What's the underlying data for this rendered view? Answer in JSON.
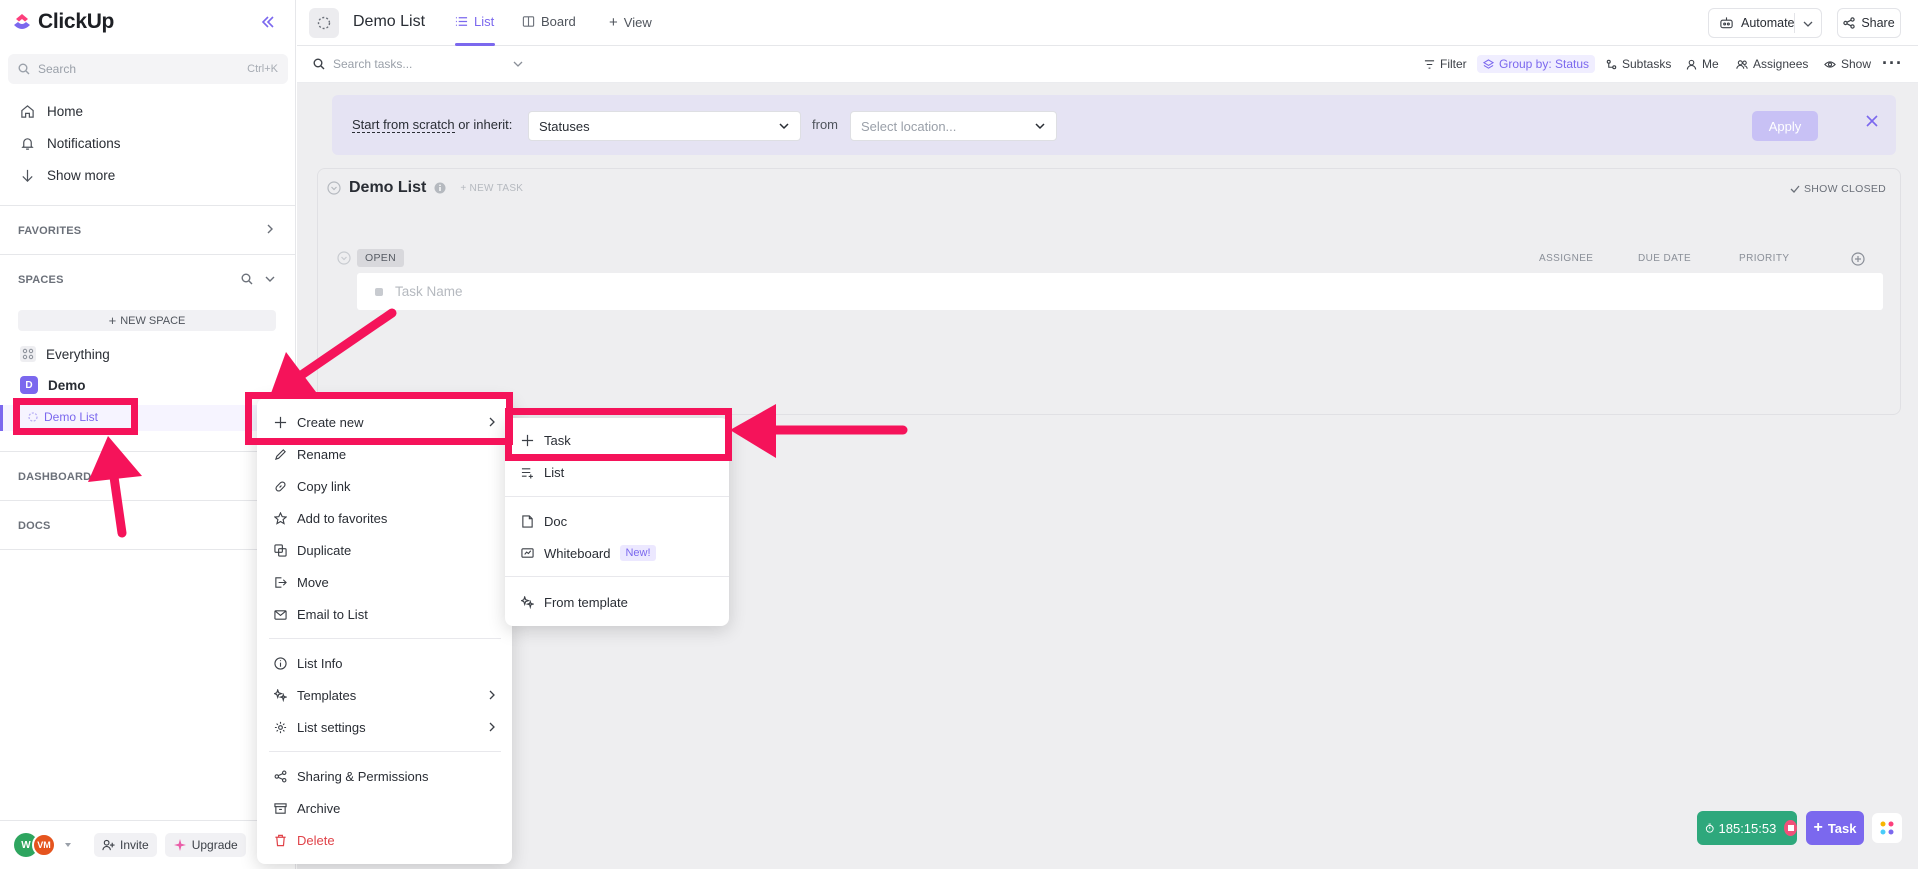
{
  "app": {
    "name": "ClickUp"
  },
  "sidebar": {
    "search_placeholder": "Search",
    "search_shortcut": "Ctrl+K",
    "nav": [
      {
        "label": "Home",
        "icon": "home-icon"
      },
      {
        "label": "Notifications",
        "icon": "bell-icon"
      },
      {
        "label": "Show more",
        "icon": "arrow-down-icon"
      }
    ],
    "favorites_label": "FAVORITES",
    "spaces_label": "SPACES",
    "new_space_label": "NEW SPACE",
    "everything_label": "Everything",
    "space": {
      "initial": "D",
      "name": "Demo",
      "color": "#7b68ee"
    },
    "active_list": "Demo List",
    "dashboards_label": "DASHBOARDS",
    "docs_label": "DOCS",
    "bottom": {
      "avatar_1": "W",
      "avatar_2": "VM",
      "invite_label": "Invite",
      "upgrade_label": "Upgrade"
    }
  },
  "header": {
    "title": "Demo List",
    "tabs": [
      {
        "label": "List",
        "active": true
      },
      {
        "label": "Board",
        "active": false
      }
    ],
    "add_view_label": "View",
    "automate_label": "Automate",
    "share_label": "Share"
  },
  "toolbar": {
    "search_placeholder": "Search tasks...",
    "filter_label": "Filter",
    "group_label": "Group by: Status",
    "subtasks_label": "Subtasks",
    "me_label": "Me",
    "assignees_label": "Assignees",
    "show_label": "Show"
  },
  "inherit_banner": {
    "start_label": "Start from scratch",
    "or_label": " or inherit:",
    "statuses_value": "Statuses",
    "from_label": "from",
    "location_placeholder": "Select location...",
    "apply_label": "Apply"
  },
  "list": {
    "title": "Demo List",
    "new_task_label": "+ NEW TASK",
    "show_closed_label": "SHOW CLOSED",
    "status_label": "OPEN",
    "columns": [
      "ASSIGNEE",
      "DUE DATE",
      "PRIORITY"
    ],
    "task_placeholder": "Task Name"
  },
  "timer": {
    "value": "185:15:53"
  },
  "task_fab_label": "Task",
  "context_menu": {
    "items": [
      {
        "label": "Create new",
        "icon": "plus-icon",
        "submenu": true
      },
      {
        "label": "Rename",
        "icon": "pencil-icon"
      },
      {
        "label": "Copy link",
        "icon": "link-icon"
      },
      {
        "label": "Add to favorites",
        "icon": "star-icon"
      },
      {
        "label": "Duplicate",
        "icon": "duplicate-icon"
      },
      {
        "label": "Move",
        "icon": "move-icon"
      },
      {
        "label": "Email to List",
        "icon": "mail-icon"
      },
      {
        "label": "List Info",
        "icon": "info-icon"
      },
      {
        "label": "Templates",
        "icon": "templates-icon",
        "submenu": true
      },
      {
        "label": "List settings",
        "icon": "gear-icon",
        "submenu": true
      },
      {
        "label": "Sharing & Permissions",
        "icon": "share-icon"
      },
      {
        "label": "Archive",
        "icon": "archive-icon"
      },
      {
        "label": "Delete",
        "icon": "trash-icon",
        "danger": true
      }
    ]
  },
  "create_submenu": {
    "items": [
      {
        "label": "Task",
        "icon": "plus-icon"
      },
      {
        "label": "List",
        "icon": "list-add-icon"
      },
      {
        "label": "Doc",
        "icon": "doc-icon"
      },
      {
        "label": "Whiteboard",
        "icon": "whiteboard-icon",
        "badge": "New!"
      },
      {
        "label": "From template",
        "icon": "template-icon"
      }
    ]
  },
  "colors": {
    "accent": "#7b68ee",
    "annotation": "#f5135a",
    "danger": "#e04349",
    "timer": "#2ea87c"
  }
}
